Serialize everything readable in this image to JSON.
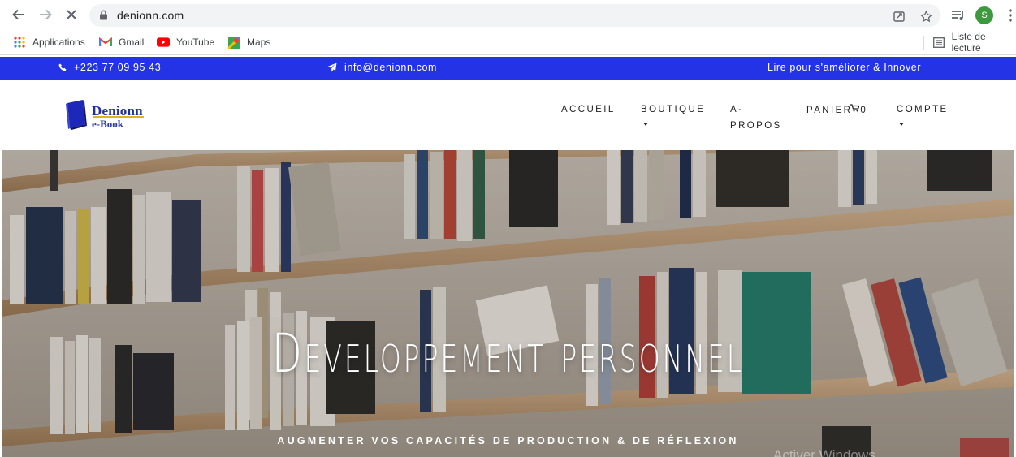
{
  "browser": {
    "url": "denionn.com",
    "avatar_initial": "S",
    "bookmarks": [
      {
        "label": "Applications",
        "icon": "apps-grid-icon"
      },
      {
        "label": "Gmail",
        "icon": "gmail-icon"
      },
      {
        "label": "YouTube",
        "icon": "youtube-icon"
      },
      {
        "label": "Maps",
        "icon": "maps-icon"
      }
    ],
    "reading_list": "Liste de lecture"
  },
  "topbar": {
    "phone": "+223 77 09 95 43",
    "email": "info@denionn.com",
    "tagline": "Lire pour s'améliorer & Innover",
    "background": "#2433e6"
  },
  "header": {
    "logo_title": "Denionn",
    "logo_subtitle": "e-Book",
    "menu": {
      "home": "ACCUEIL",
      "shop": "BOUTIQUE",
      "about_line1": "A-",
      "about_line2": "PROPOS",
      "cart": "PANIER",
      "cart_count": "0",
      "account": "COMPTE"
    }
  },
  "hero": {
    "title": "Developpement personnel",
    "subtitle": "Augmenter vos capacités de production & de réflexion",
    "watermark": "Activer Windows"
  }
}
